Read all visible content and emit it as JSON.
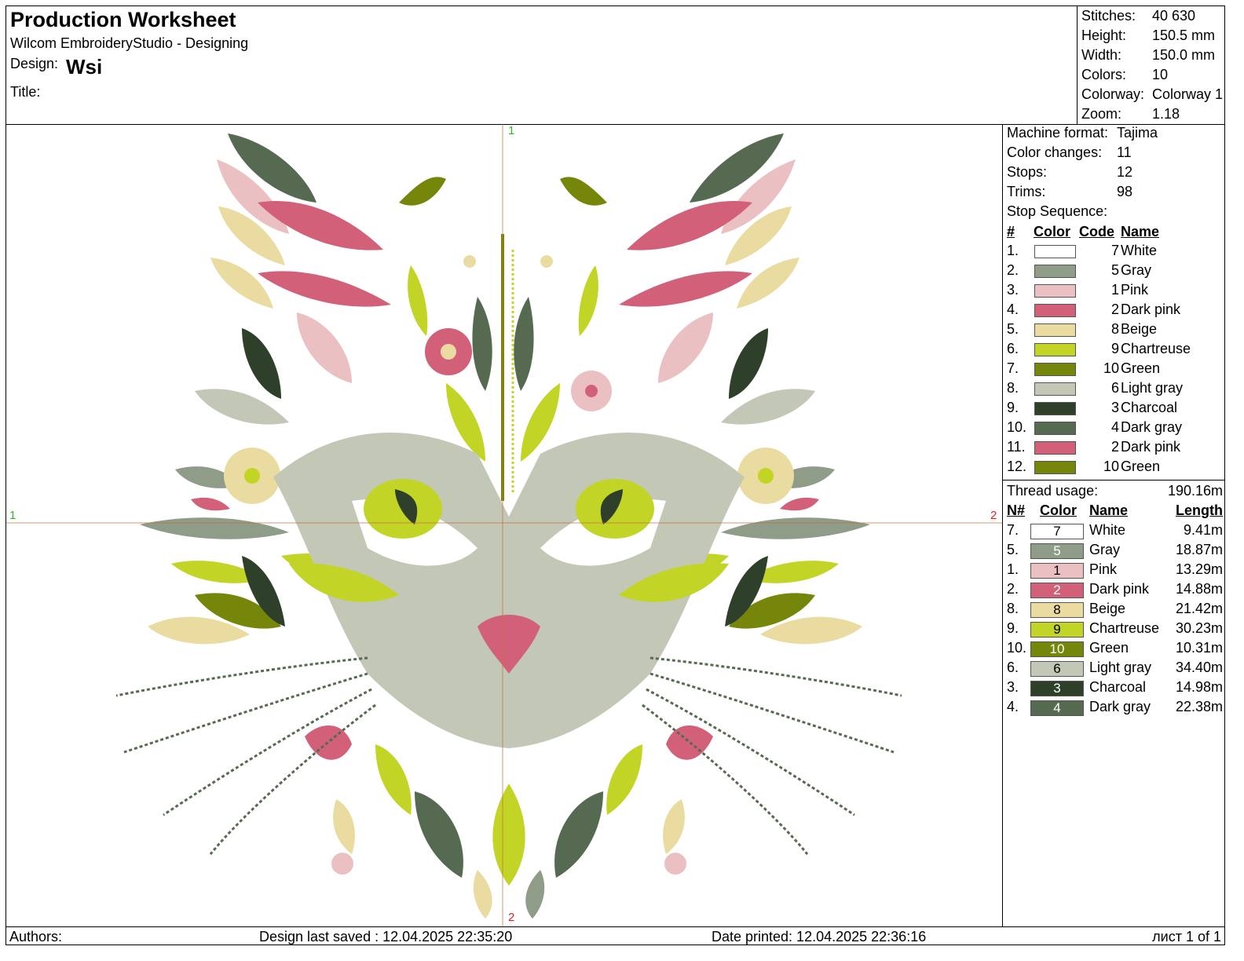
{
  "header": {
    "title": "Production Worksheet",
    "software": "Wilcom EmbroideryStudio - Designing",
    "design_label": "Design:",
    "design_value": "Wsi",
    "title_label": "Title:"
  },
  "stats": [
    {
      "label": "Stitches:",
      "value": "40 630"
    },
    {
      "label": "Height:",
      "value": "150.5 mm"
    },
    {
      "label": "Width:",
      "value": "150.0 mm"
    },
    {
      "label": "Colors:",
      "value": "10"
    },
    {
      "label": "Colorway:",
      "value": "Colorway 1"
    },
    {
      "label": "Zoom:",
      "value": "1.18"
    }
  ],
  "machine": [
    {
      "label": "Machine format:",
      "value": "Tajima"
    },
    {
      "label": "Color changes:",
      "value": "11"
    },
    {
      "label": "Stops:",
      "value": "12"
    },
    {
      "label": "Trims:",
      "value": "98"
    }
  ],
  "stop_sequence_label": "Stop Sequence:",
  "stop_headers": {
    "num": "#",
    "color": "Color",
    "code": "Code",
    "name": "Name"
  },
  "stop_sequence": [
    {
      "n": "1.",
      "code": "7",
      "name": "White",
      "hex": "#ffffff"
    },
    {
      "n": "2.",
      "code": "5",
      "name": "Gray",
      "hex": "#8e9c88"
    },
    {
      "n": "3.",
      "code": "1",
      "name": "Pink",
      "hex": "#ebc0c3"
    },
    {
      "n": "4.",
      "code": "2",
      "name": "Dark pink",
      "hex": "#d26079"
    },
    {
      "n": "5.",
      "code": "8",
      "name": "Beige",
      "hex": "#eadca1"
    },
    {
      "n": "6.",
      "code": "9",
      "name": "Chartreuse",
      "hex": "#c2d526"
    },
    {
      "n": "7.",
      "code": "10",
      "name": "Green",
      "hex": "#76860b"
    },
    {
      "n": "8.",
      "code": "6",
      "name": "Light gray",
      "hex": "#c3c7b6"
    },
    {
      "n": "9.",
      "code": "3",
      "name": "Charcoal",
      "hex": "#2e4029"
    },
    {
      "n": "10.",
      "code": "4",
      "name": "Dark gray",
      "hex": "#566a51"
    },
    {
      "n": "11.",
      "code": "2",
      "name": "Dark pink",
      "hex": "#d26079"
    },
    {
      "n": "12.",
      "code": "10",
      "name": "Green",
      "hex": "#76860b"
    }
  ],
  "thread_usage_label": "Thread usage:",
  "thread_usage_total": "190.16m",
  "usage_headers": {
    "num": "N#",
    "color": "Color",
    "name": "Name",
    "length": "Length"
  },
  "thread_usage": [
    {
      "n": "7.",
      "code": "7",
      "name": "White",
      "length": "9.41m",
      "hex": "#ffffff",
      "fg": "#000000"
    },
    {
      "n": "5.",
      "code": "5",
      "name": "Gray",
      "length": "18.87m",
      "hex": "#8e9c88",
      "fg": "#ffffff"
    },
    {
      "n": "1.",
      "code": "1",
      "name": "Pink",
      "length": "13.29m",
      "hex": "#ebc0c3",
      "fg": "#000000"
    },
    {
      "n": "2.",
      "code": "2",
      "name": "Dark pink",
      "length": "14.88m",
      "hex": "#d26079",
      "fg": "#ffffff"
    },
    {
      "n": "8.",
      "code": "8",
      "name": "Beige",
      "length": "21.42m",
      "hex": "#eadca1",
      "fg": "#000000"
    },
    {
      "n": "9.",
      "code": "9",
      "name": "Chartreuse",
      "length": "30.23m",
      "hex": "#c2d526",
      "fg": "#000000"
    },
    {
      "n": "10.",
      "code": "10",
      "name": "Green",
      "length": "10.31m",
      "hex": "#76860b",
      "fg": "#ffffff"
    },
    {
      "n": "6.",
      "code": "6",
      "name": "Light gray",
      "length": "34.40m",
      "hex": "#c3c7b6",
      "fg": "#000000"
    },
    {
      "n": "3.",
      "code": "3",
      "name": "Charcoal",
      "length": "14.98m",
      "hex": "#2e4029",
      "fg": "#ffffff"
    },
    {
      "n": "4.",
      "code": "4",
      "name": "Dark gray",
      "length": "22.38m",
      "hex": "#566a51",
      "fg": "#ffffff"
    }
  ],
  "axis_markers": {
    "top": "1",
    "left": "1",
    "right": "2",
    "bottom": "2"
  },
  "footer": {
    "authors": "Authors:",
    "saved": "Design last saved : 12.04.2025 22:35:20",
    "printed": "Date printed: 12.04.2025 22:36:16",
    "page": "лист 1 of 1"
  }
}
